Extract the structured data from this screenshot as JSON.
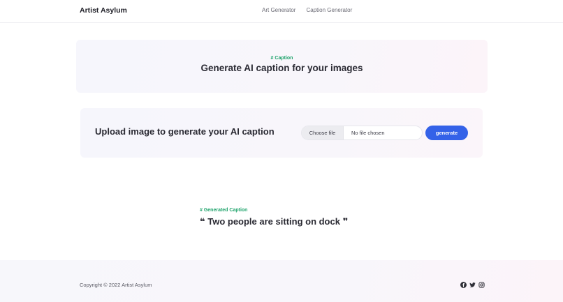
{
  "header": {
    "brand": "Artist Asylum",
    "nav": [
      {
        "label": "Art Generator"
      },
      {
        "label": "Caption Generator"
      }
    ]
  },
  "hero": {
    "eyebrow": "# Caption",
    "title": "Generate AI caption for your images"
  },
  "upload": {
    "title": "Upload image to generate your AI caption",
    "choose_file_label": "Choose file",
    "file_name": "No file chosen",
    "generate_label": "generate"
  },
  "result": {
    "eyebrow": "# Generated Caption",
    "caption": "❝ Two people are sitting on dock ❞"
  },
  "footer": {
    "copyright": "Copyright © 2022 Artist Asylum",
    "socials": [
      "facebook-icon",
      "twitter-icon",
      "instagram-icon"
    ]
  },
  "colors": {
    "accent": "#3462e8",
    "eyebrow": "#1ea36b"
  }
}
